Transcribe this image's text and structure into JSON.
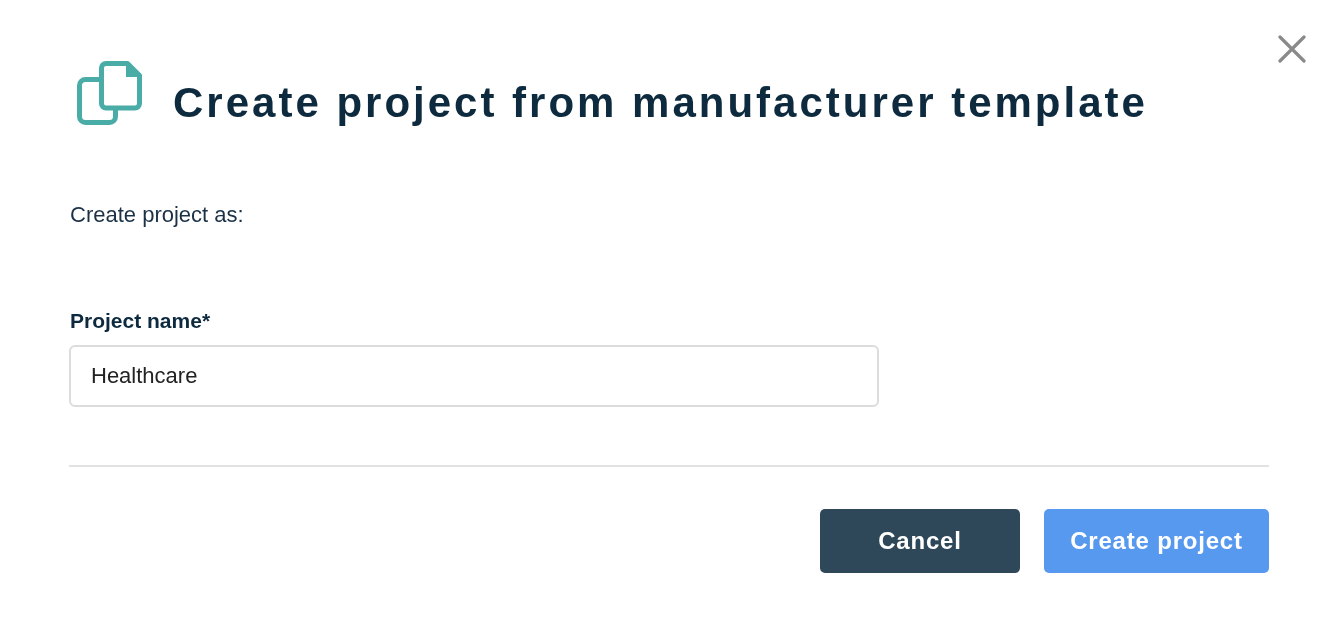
{
  "dialog": {
    "title": "Create project from manufacturer template",
    "intro": "Create project as:",
    "field": {
      "label": "Project name*",
      "value": "Healthcare"
    },
    "buttons": [
      {
        "label": "Cancel",
        "kind": "secondary"
      },
      {
        "label": "Create project",
        "kind": "primary"
      }
    ]
  }
}
